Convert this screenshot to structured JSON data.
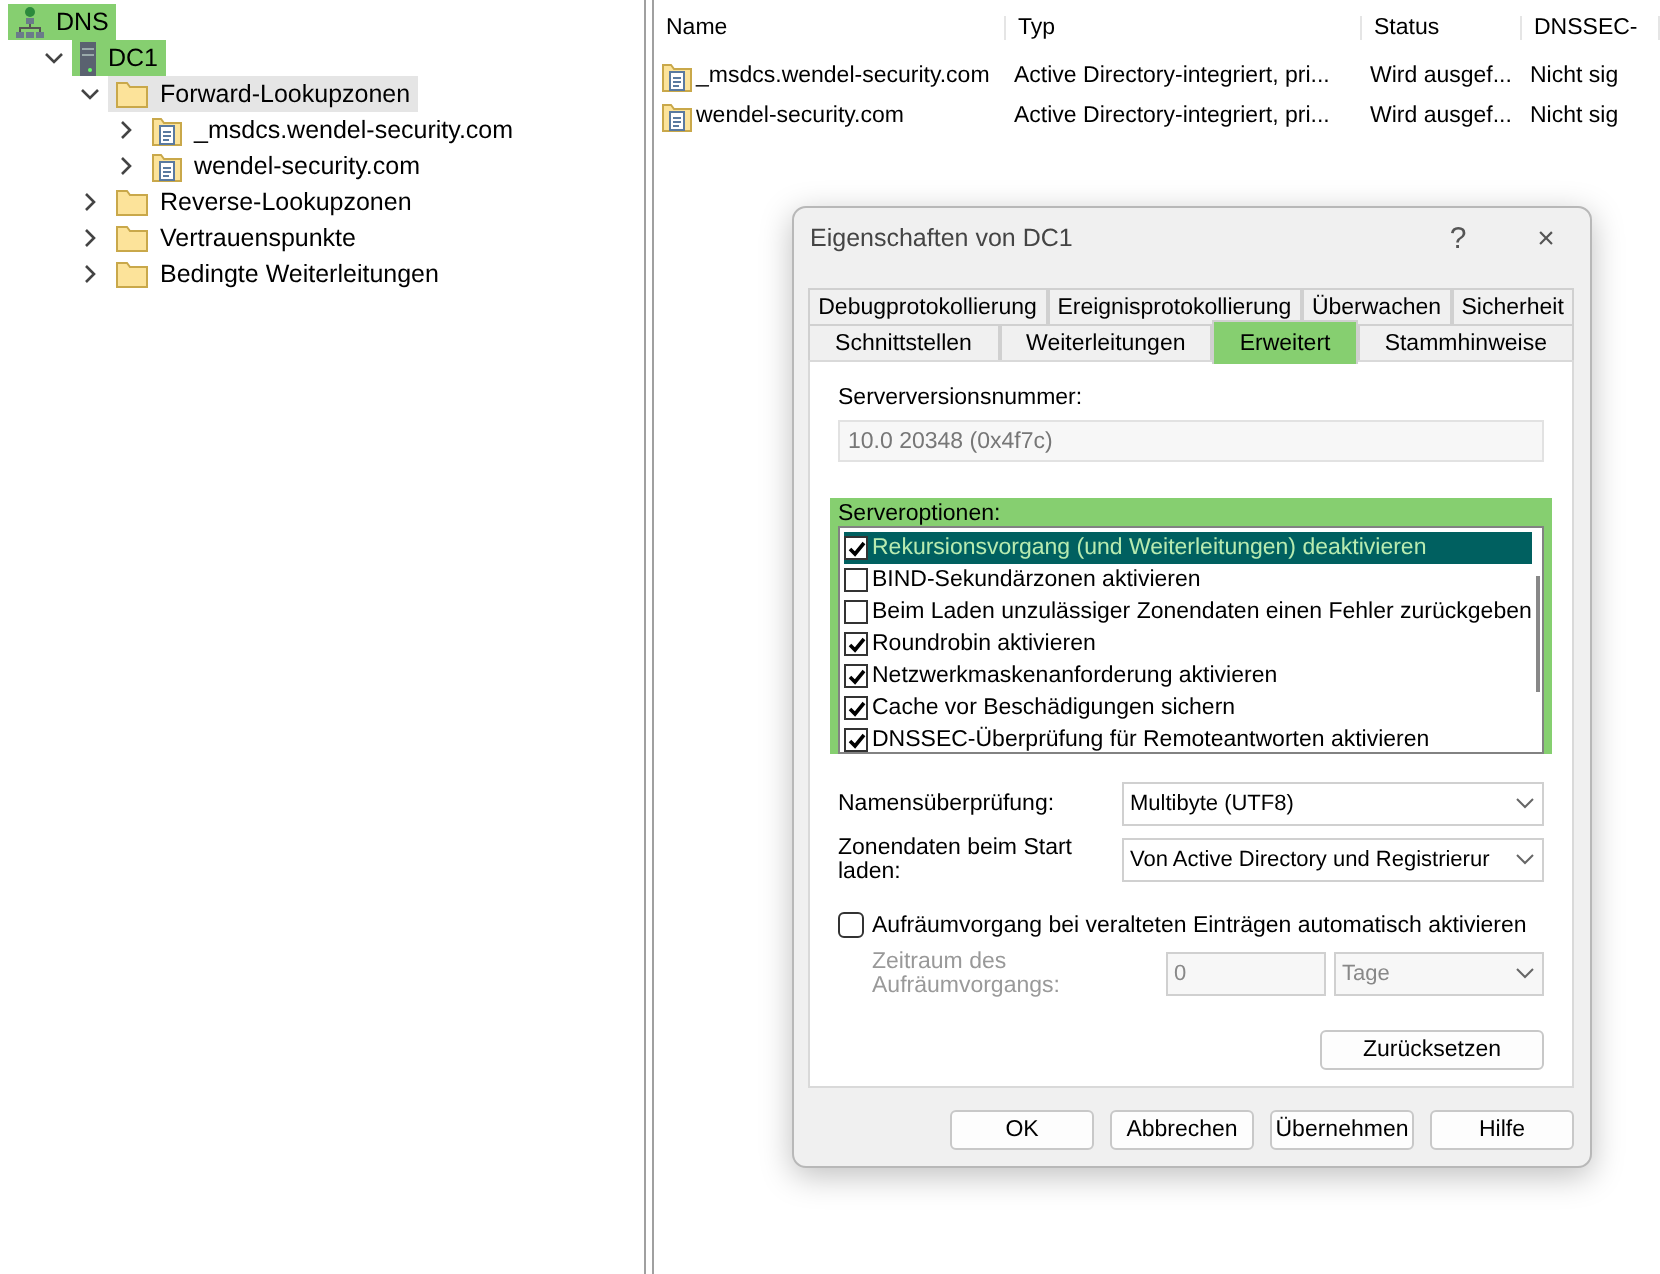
{
  "tree": [
    {
      "label": "DNS",
      "kind": "root",
      "highlighted": true,
      "children": [
        {
          "label": "DC1",
          "kind": "server",
          "highlighted": true,
          "expanded": true,
          "children": [
            {
              "label": "Forward-Lookupzonen",
              "kind": "folder",
              "highlighted": false,
              "expanded": true,
              "selected": true,
              "children": [
                {
                  "label": "_msdcs.wendel-security.com",
                  "kind": "zone",
                  "highlighted": false,
                  "expanded": false,
                  "selected": false
                },
                {
                  "label": "wendel-security.com",
                  "kind": "zone",
                  "highlighted": false,
                  "expanded": false,
                  "selected": false
                }
              ]
            },
            {
              "label": "Reverse-Lookupzonen",
              "kind": "folder",
              "highlighted": false,
              "expanded": false,
              "selected": false
            },
            {
              "label": "Vertrauenspunkte",
              "kind": "folder",
              "highlighted": false,
              "expanded": false,
              "selected": false
            },
            {
              "label": "Bedingte Weiterleitungen",
              "kind": "folder",
              "highlighted": false,
              "expanded": false,
              "selected": false
            }
          ]
        }
      ]
    }
  ],
  "table": {
    "columns": [
      "Name",
      "Typ",
      "Status",
      "DNSSEC-"
    ],
    "rows": [
      [
        "_msdcs.wendel-security.com",
        "Active Directory-integriert, pri...",
        "Wird ausgef...",
        "Nicht sig"
      ],
      [
        "wendel-security.com",
        "Active Directory-integriert, pri...",
        "Wird ausgef...",
        "Nicht sig"
      ]
    ]
  },
  "dialog": {
    "title": "Eigenschaften von DC1",
    "help": "?",
    "close": "×",
    "tab_rows": [
      [
        {
          "label": "Debugprotokollierung",
          "selected": false,
          "highlighted": false
        },
        {
          "label": "Ereignisprotokollierung",
          "selected": false,
          "highlighted": false
        },
        {
          "label": "Überwachen",
          "selected": false,
          "highlighted": false
        },
        {
          "label": "Sicherheit",
          "selected": false,
          "highlighted": false
        }
      ],
      [
        {
          "label": "Schnittstellen",
          "selected": false,
          "highlighted": false
        },
        {
          "label": "Weiterleitungen",
          "selected": false,
          "highlighted": false
        },
        {
          "label": "Erweitert",
          "selected": true,
          "highlighted": true
        },
        {
          "label": "Stammhinweise",
          "selected": false,
          "highlighted": false
        }
      ]
    ],
    "version_label": "Serverversionsnummer:",
    "version_value": "10.0 20348 (0x4f7c)",
    "options_label": "Serveroptionen:",
    "options_highlighted": true,
    "options": [
      {
        "label": "Rekursionsvorgang (und Weiterleitungen) deaktivieren",
        "checked": true,
        "selected": true
      },
      {
        "label": "BIND-Sekundärzonen aktivieren",
        "checked": false,
        "selected": false
      },
      {
        "label": "Beim Laden unzulässiger Zonendaten einen Fehler zurückgeben",
        "checked": false,
        "selected": false
      },
      {
        "label": "Roundrobin aktivieren",
        "checked": true,
        "selected": false
      },
      {
        "label": "Netzwerkmaskenanforderung aktivieren",
        "checked": true,
        "selected": false
      },
      {
        "label": "Cache vor Beschädigungen sichern",
        "checked": true,
        "selected": false
      },
      {
        "label": "DNSSEC-Überprüfung für Remoteantworten aktivieren",
        "checked": true,
        "selected": false
      }
    ],
    "name_check": {
      "label": "Namensüberprüfung:",
      "value": "Multibyte (UTF8)"
    },
    "load_zone": {
      "label": "Zonendaten beim Start laden:",
      "value": "Von Active Directory und Registrierur"
    },
    "scavenging": {
      "label": "Aufräumvorgang bei veralteten Einträgen automatisch aktivieren",
      "checked": false
    },
    "period": {
      "label": "Zeitraum des Aufräumvorgangs:",
      "value": "0",
      "unit": "Tage",
      "disabled": true
    },
    "reset": "Zurücksetzen",
    "buttons": [
      "OK",
      "Abbrechen",
      "Übernehmen",
      "Hilfe"
    ]
  }
}
